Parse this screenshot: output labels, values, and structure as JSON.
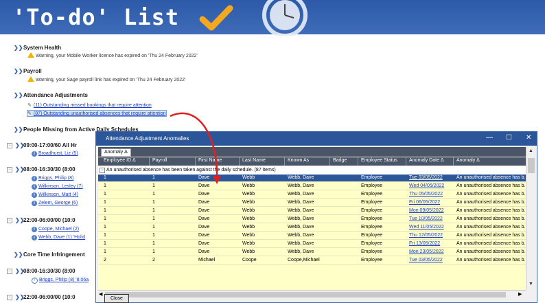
{
  "banner": {
    "title": "'To-do' List",
    "check_icon": "checkmark-icon",
    "clock_icon": "clock-icon"
  },
  "sections": [
    {
      "title": "System Health",
      "items": [
        "Warning, your Mobile Worker licence has expired on 'Thu 24 February 2022'"
      ]
    },
    {
      "title": "Payroll",
      "items": [
        "Warning, your Sage payroll link has expired on 'Thu 24 February 2022'"
      ]
    },
    {
      "title": "Attendance Adjustments",
      "items": [
        "(11) Outstanding missed bookings that require attention",
        "(87) Outstanding unauthorised absences that require attention"
      ]
    },
    {
      "title": "People Missing from Active Daily Schedules"
    },
    {
      "title": "Core Time Infringement"
    }
  ],
  "schedules": [
    {
      "label": "09:00-17:00/60 All Hr",
      "people": [
        "Broadhurst, Liz (5)"
      ]
    },
    {
      "label": "08:00-16:30/30 (8:00",
      "people": [
        "Briggs, Philip (8)",
        "Wilkinson, Lesley (7)",
        "Wilkinson, Matt (4)",
        "Zelem, George (6)"
      ]
    },
    {
      "label": "22:00-06:00/00 (10:0",
      "people": [
        "Coope, Michael (2)",
        "Webb, Dave (1) 'Holid"
      ]
    },
    {
      "label": "08:00-16:30/30 (8:00",
      "people": [
        "Briggs, Philip (8) '8:06a"
      ]
    },
    {
      "label": "22:00-06:00/00 (10:0",
      "people": []
    }
  ],
  "dialog": {
    "title": "Attendance Adjustment Anomalies",
    "group_chip": "Anomaly Δ",
    "columns": [
      "Employee ID Δ",
      "Payroll",
      "First Name",
      "Last Name",
      "Known As",
      "Badge",
      "Employee Status",
      "Anomaly Date Δ",
      "Anomaly Δ"
    ],
    "group_row": "An unauthorised absence has been taken against the daily schedule. (87 items)",
    "rows": [
      [
        "1",
        "1",
        "Dave",
        "Webb",
        "Webb, Dave",
        "",
        "Employee",
        "Tue 03/05/2022",
        "An unauthorised absence has b..."
      ],
      [
        "1",
        "1",
        "Dave",
        "Webb",
        "Webb, Dave",
        "",
        "Employee",
        "Wed 04/05/2022",
        "An unauthorised absence has b..."
      ],
      [
        "1",
        "1",
        "Dave",
        "Webb",
        "Webb, Dave",
        "",
        "Employee",
        "Thu 05/05/2022",
        "An unauthorised absence has b..."
      ],
      [
        "1",
        "1",
        "Dave",
        "Webb",
        "Webb, Dave",
        "",
        "Employee",
        "Fri 06/05/2022",
        "An unauthorised absence has b..."
      ],
      [
        "1",
        "1",
        "Dave",
        "Webb",
        "Webb, Dave",
        "",
        "Employee",
        "Mon 09/05/2022",
        "An unauthorised absence has b..."
      ],
      [
        "1",
        "1",
        "Dave",
        "Webb",
        "Webb, Dave",
        "",
        "Employee",
        "Tue 10/05/2022",
        "An unauthorised absence has b..."
      ],
      [
        "1",
        "1",
        "Dave",
        "Webb",
        "Webb, Dave",
        "",
        "Employee",
        "Wed 11/05/2022",
        "An unauthorised absence has b..."
      ],
      [
        "1",
        "1",
        "Dave",
        "Webb",
        "Webb, Dave",
        "",
        "Employee",
        "Thu 12/05/2022",
        "An unauthorised absence has b..."
      ],
      [
        "1",
        "1",
        "Dave",
        "Webb",
        "Webb, Dave",
        "",
        "Employee",
        "Fri 13/05/2022",
        "An unauthorised absence has b..."
      ],
      [
        "1",
        "1",
        "Dave",
        "Webb",
        "Webb, Dave",
        "",
        "Employee",
        "Mon 23/05/2022",
        "An unauthorised absence has b..."
      ],
      [
        "2",
        "2",
        "Michael",
        "Coope",
        "Coope,Michael",
        "",
        "Employee",
        "Tue 03/05/2022",
        "An unauthorised absence has b..."
      ]
    ],
    "close_label": "Close",
    "controls": {
      "minimize": "—",
      "maximize": "☐",
      "close": "✕"
    }
  },
  "colors": {
    "banner_bg": "#2c5aa8",
    "accent": "#2b579a",
    "row_bg": "#ffffc8",
    "arrow": "#e02020",
    "link": "#1d3fbd"
  }
}
